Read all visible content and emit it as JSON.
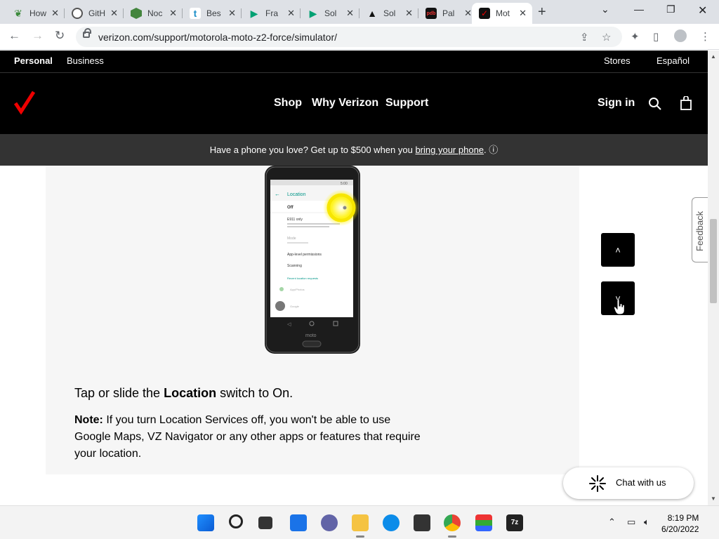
{
  "browser": {
    "tabs": [
      {
        "label": "How",
        "favicon": "leaf-icon",
        "color": "#3c8a3c"
      },
      {
        "label": "GitH",
        "favicon": "github-icon",
        "color": "#24292f"
      },
      {
        "label": "Noc",
        "favicon": "hexagon-icon",
        "color": "#43853d"
      },
      {
        "label": "Bes",
        "favicon": "tumblr-icon",
        "color": "#1e90c8"
      },
      {
        "label": "Fra",
        "favicon": "play-icon",
        "color": "#00a173"
      },
      {
        "label": "Sol",
        "favicon": "play-icon",
        "color": "#00a173"
      },
      {
        "label": "Sol",
        "favicon": "triangle-icon",
        "color": "#111111"
      },
      {
        "label": "Pal",
        "favicon": "pdb-icon",
        "color": "#111111"
      },
      {
        "label": "Mot",
        "favicon": "verizon-check-icon",
        "color": "#ee0000"
      }
    ],
    "url": "verizon.com/support/motorola-moto-z2-force/simulator/"
  },
  "site": {
    "topbar": {
      "personal": "Personal",
      "business": "Business",
      "stores": "Stores",
      "espanol": "Español"
    },
    "nav": {
      "shop": "Shop",
      "why": "Why Verizon",
      "support": "Support",
      "signin": "Sign in"
    },
    "promo": {
      "text": "Have a phone you love? Get up to $500 when you ",
      "link": "bring your phone",
      "suffix": ". ⓘ"
    },
    "step": {
      "title_pre": "Tap or slide the ",
      "title_bold": "Location",
      "title_post": " switch to On.",
      "note_label": "Note:",
      "note_text": " If you turn Location Services off, you won't be able to use Google Maps, VZ Navigator or any other apps or features that require your location."
    },
    "phone": {
      "header": "Location",
      "off_label": "Off",
      "items": [
        "E911 only",
        "Mode",
        "App-level permissions",
        "Scanning",
        "Recent location requests",
        "App/Photos",
        "Google"
      ],
      "brand": "moto",
      "status_time": "5:00"
    },
    "feedback": "Feedback",
    "chat": "Chat with us",
    "brand_red": "#ee0000"
  },
  "taskbar": {
    "time": "8:19 PM",
    "date": "6/20/2022"
  }
}
